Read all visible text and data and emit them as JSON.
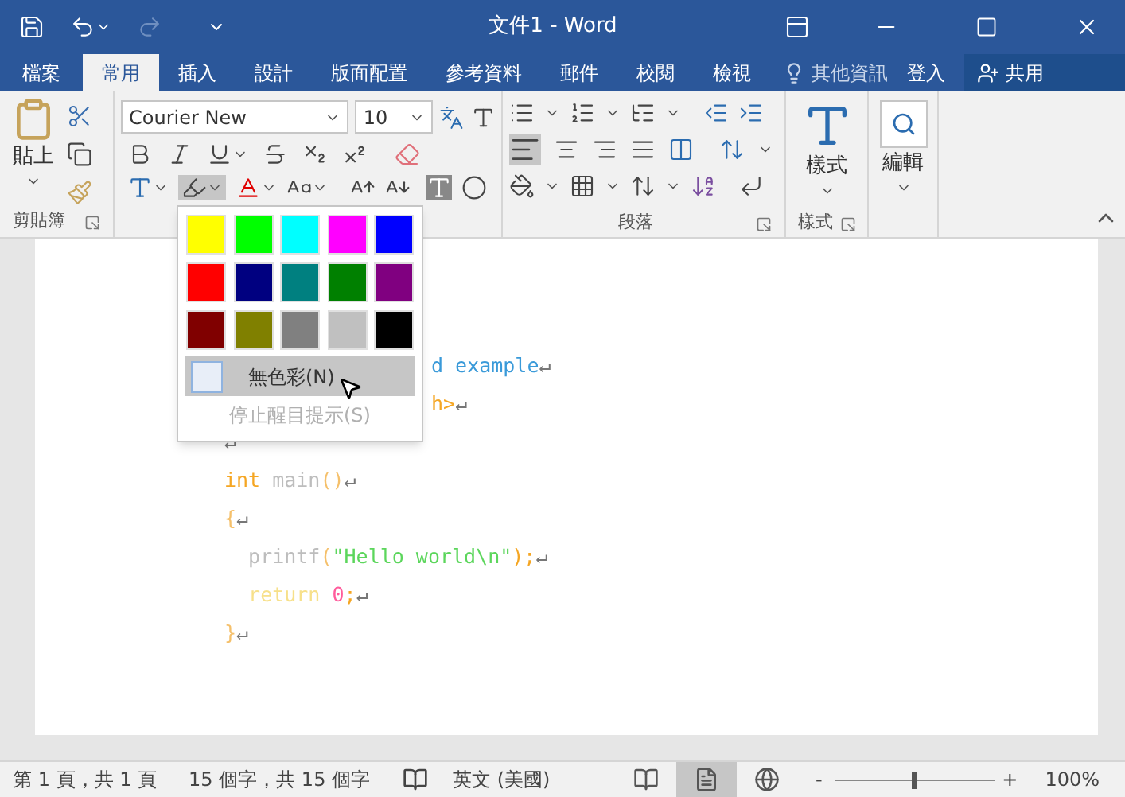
{
  "window": {
    "title": "文件1 - Word"
  },
  "tabs": [
    {
      "label": "檔案",
      "selected": false,
      "kind": "file"
    },
    {
      "label": "常用",
      "selected": true
    },
    {
      "label": "插入",
      "selected": false
    },
    {
      "label": "設計",
      "selected": false
    },
    {
      "label": "版面配置",
      "selected": false
    },
    {
      "label": "參考資料",
      "selected": false
    },
    {
      "label": "郵件",
      "selected": false
    },
    {
      "label": "校閱",
      "selected": false
    },
    {
      "label": "檢視",
      "selected": false
    }
  ],
  "tell_me": "其他資訊",
  "sign_in": "登入",
  "share": "共用",
  "ribbon": {
    "paste": "貼上",
    "clipboard_label": "剪貼簿",
    "font_name": "Courier New",
    "font_size": "10",
    "paragraph_label": "段落",
    "styles": "樣式",
    "styles_label": "樣式",
    "editing": "編輯"
  },
  "highlight_menu": {
    "swatches": [
      {
        "color": "#ffff00"
      },
      {
        "color": "#00ff00"
      },
      {
        "color": "#00ffff"
      },
      {
        "color": "#ff00ff"
      },
      {
        "color": "#0000ff"
      },
      {
        "color": "#ff0000"
      },
      {
        "color": "#000080"
      },
      {
        "color": "#008080"
      },
      {
        "color": "#008000"
      },
      {
        "color": "#800080"
      },
      {
        "color": "#800000"
      },
      {
        "color": "#808000"
      },
      {
        "color": "#808080"
      },
      {
        "color": "#c0c0c0"
      },
      {
        "color": "#000000"
      }
    ],
    "no_color": {
      "label": "無色彩(N)",
      "selected": true
    },
    "stop": {
      "label": "停止醒目提示(S)",
      "disabled": true
    }
  },
  "document": [
    {
      "kind": "covered",
      "segments": [
        {
          "text": "d example",
          "color": "#3a9ad9"
        },
        {
          "text": "↵",
          "color": "#777777"
        }
      ]
    },
    {
      "kind": "covered",
      "segments": [
        {
          "text": "h>",
          "color": "#f5a623"
        },
        {
          "text": "↵",
          "color": "#777777"
        }
      ]
    },
    {
      "kind": "line",
      "segments": [
        {
          "text": "↵",
          "color": "#777777"
        }
      ]
    },
    {
      "kind": "line",
      "segments": [
        {
          "text": "int",
          "color": "#f5a623"
        },
        {
          "text": " main",
          "color": "#bdbdbd"
        },
        {
          "text": "()",
          "color": "#f5c06b"
        },
        {
          "text": "↵",
          "color": "#777777"
        }
      ]
    },
    {
      "kind": "line",
      "segments": [
        {
          "text": "{",
          "color": "#f5c06b"
        },
        {
          "text": "↵",
          "color": "#777777"
        }
      ]
    },
    {
      "kind": "line",
      "segments": [
        {
          "text": "  printf",
          "color": "#bdbdbd"
        },
        {
          "text": "(",
          "color": "#f5c06b"
        },
        {
          "text": "\"Hello world\\n\"",
          "color": "#5cd65c"
        },
        {
          "text": ");",
          "color": "#f5a623"
        },
        {
          "text": "↵",
          "color": "#777777"
        }
      ]
    },
    {
      "kind": "line",
      "segments": [
        {
          "text": "  return",
          "color": "#f7e08a"
        },
        {
          "text": " 0",
          "color": "#ff5c9c"
        },
        {
          "text": ";",
          "color": "#f5a623"
        },
        {
          "text": "↵",
          "color": "#777777"
        }
      ]
    },
    {
      "kind": "line",
      "segments": [
        {
          "text": "}",
          "color": "#f5c06b"
        },
        {
          "text": "↵",
          "color": "#777777"
        }
      ]
    }
  ],
  "status_bar": {
    "page": "第 1 頁，共 1 頁",
    "words": "15 個字，共 15 個字",
    "language": "英文 (美國)",
    "views": [
      {
        "kind": "read",
        "selected": false
      },
      {
        "kind": "print",
        "selected": true
      },
      {
        "kind": "web",
        "selected": false
      }
    ],
    "zoom_out": "-",
    "zoom_in": "+",
    "zoom": {
      "level": 0.48
    },
    "zoom_text": "100%"
  }
}
